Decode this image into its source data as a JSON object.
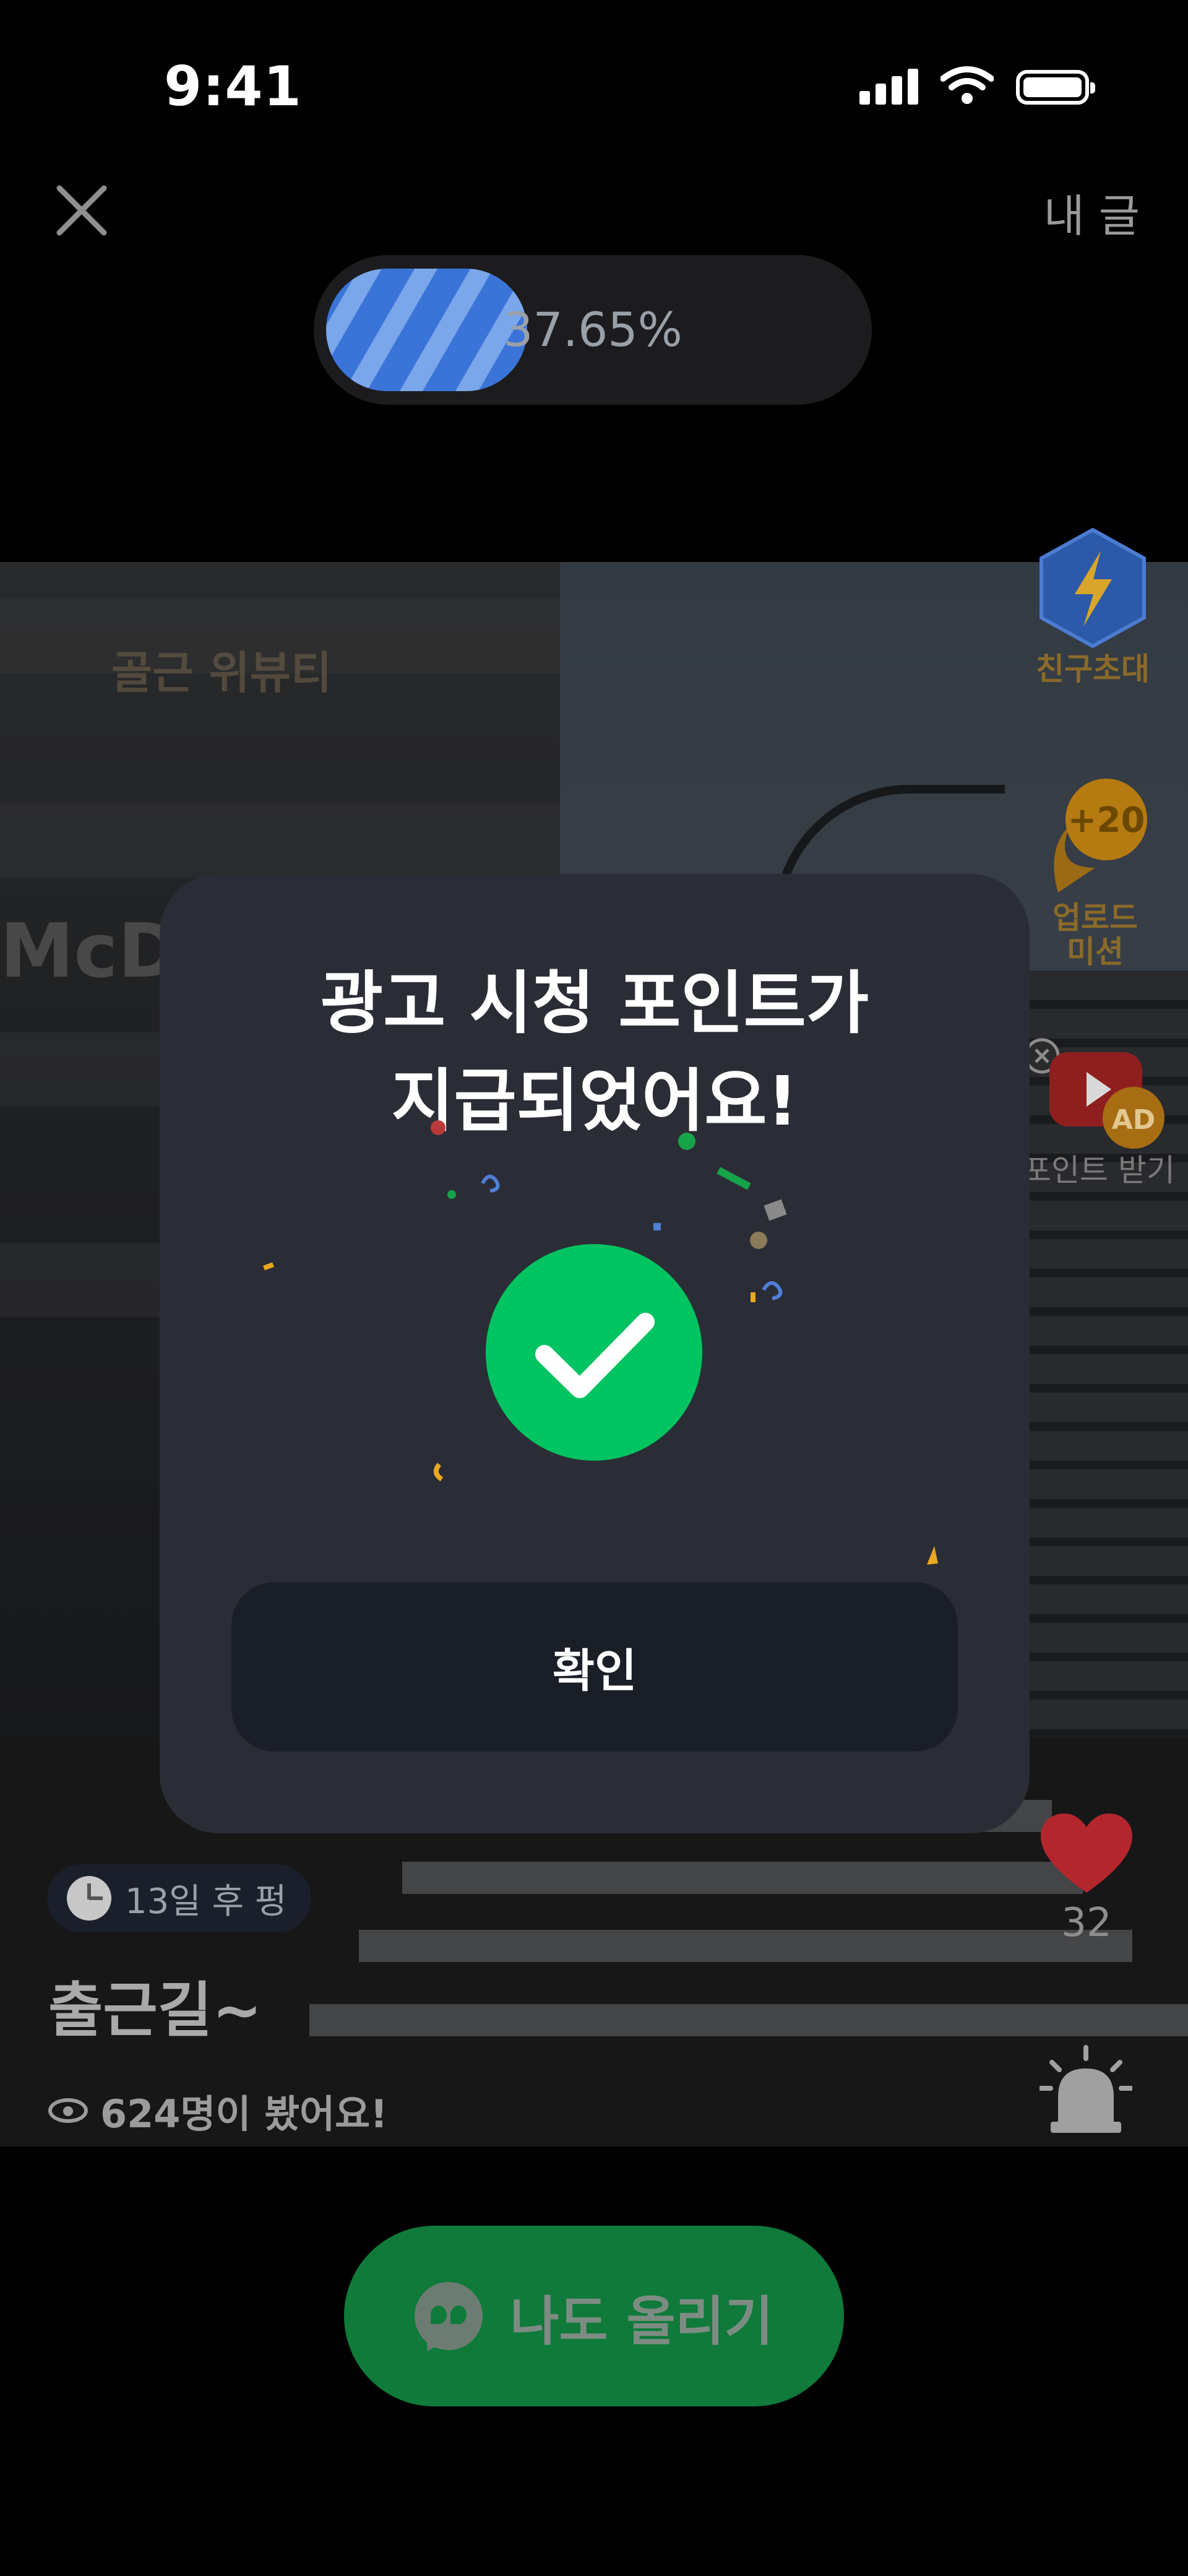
{
  "status_bar": {
    "time": "9:41"
  },
  "header": {
    "my_post_label": "내 글"
  },
  "progress": {
    "value_percent": 37.65,
    "label": "37.65%"
  },
  "video": {
    "sign_text": "골근 위뷰티",
    "store_text": "McD"
  },
  "right_rail": {
    "invite_label": "친구초대",
    "upload_badge": "+20",
    "upload_label_line1": "업로드",
    "upload_label_line2": "미션",
    "ad_badge": "AD",
    "ad_label": "포인트 받기",
    "like_count": "32"
  },
  "post": {
    "timer_text": "13일 후 펑",
    "title": "출근길~",
    "views_text": "624명이 봤어요!"
  },
  "cta": {
    "label": "나도 올리기"
  },
  "modal": {
    "title_line1": "광고 시청 포인트가",
    "title_line2": "지급되었어요!",
    "confirm_label": "확인"
  },
  "colors": {
    "accent_green": "#00c461",
    "progress_blue": "#3b74d9",
    "cta_green": "#0f7a3a",
    "modal_bg": "#2b2d36",
    "like_red": "#c0282f"
  }
}
